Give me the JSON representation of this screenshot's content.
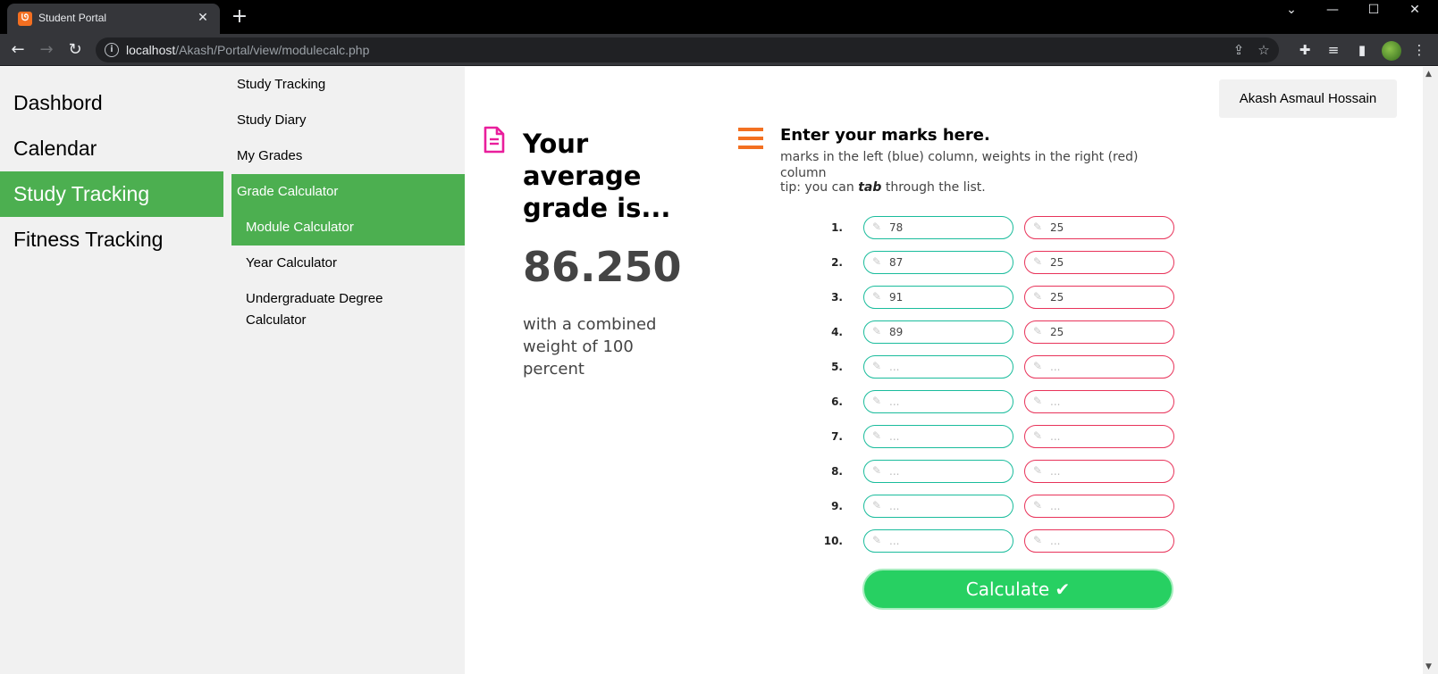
{
  "browser": {
    "tab_title": "Student Portal",
    "tab_close": "✕",
    "new_tab": "+",
    "url_host": "localhost",
    "url_path": "/Akash/Portal/view/modulecalc.php",
    "window_controls": {
      "minimize": "—",
      "maximize": "☐",
      "close": "✕",
      "dropdown": "⌄"
    }
  },
  "sidebar": {
    "main_items": [
      {
        "label": "Dashbord"
      },
      {
        "label": "Calendar"
      },
      {
        "label": "Study Tracking",
        "active": true
      },
      {
        "label": "Fitness Tracking"
      }
    ],
    "sub_items": [
      {
        "label": "Study Tracking"
      },
      {
        "label": "Study Diary"
      },
      {
        "label": "My Grades"
      },
      {
        "label": "Grade Calculator",
        "active": true
      }
    ],
    "sub_sub_items": [
      {
        "label": "Module Calculator",
        "active": true
      },
      {
        "label": "Year Calculator"
      },
      {
        "label": "Undergraduate Degree Calculator"
      }
    ]
  },
  "user": {
    "name": "Akash Asmaul Hossain"
  },
  "result": {
    "heading": "Your average grade is...",
    "value": "86.250",
    "weight_text": "with a combined weight of 100 percent"
  },
  "form": {
    "heading": "Enter your marks here.",
    "subheading": "marks in the left (blue) column, weights in the right (red) column",
    "tip_prefix": "tip: you can",
    "tip_em": "tab",
    "tip_suffix": "through the list.",
    "placeholder": "...",
    "rows": [
      {
        "label": "1.",
        "mark": "78",
        "weight": "25"
      },
      {
        "label": "2.",
        "mark": "87",
        "weight": "25"
      },
      {
        "label": "3.",
        "mark": "91",
        "weight": "25"
      },
      {
        "label": "4.",
        "mark": "89",
        "weight": "25"
      },
      {
        "label": "5.",
        "mark": "",
        "weight": ""
      },
      {
        "label": "6.",
        "mark": "",
        "weight": ""
      },
      {
        "label": "7.",
        "mark": "",
        "weight": ""
      },
      {
        "label": "8.",
        "mark": "",
        "weight": ""
      },
      {
        "label": "9.",
        "mark": "",
        "weight": ""
      },
      {
        "label": "10.",
        "mark": "",
        "weight": ""
      }
    ],
    "calculate_label": "Calculate ✔"
  },
  "colors": {
    "accent_green": "#4caf50",
    "mark_border": "#1abc9c",
    "weight_border": "#e8335a",
    "button_green": "#27d062",
    "menu_orange": "#f37021",
    "doc_magenta": "#e91e9c"
  }
}
